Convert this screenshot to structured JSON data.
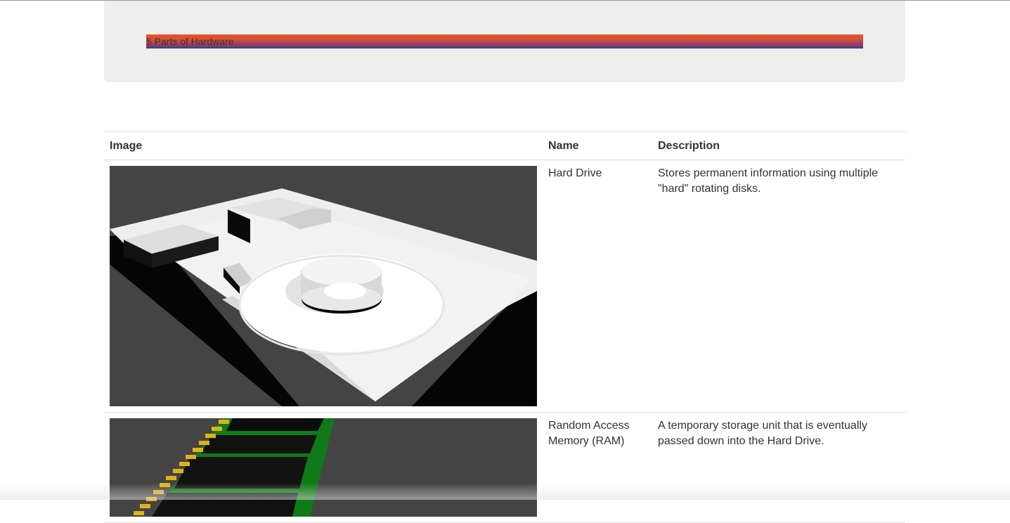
{
  "header": {
    "title": "5 Parts of Hardware"
  },
  "table": {
    "columns": [
      "Image",
      "Name",
      "Description"
    ],
    "rows": [
      {
        "name": "Hard Drive",
        "description": "Stores permanent information using multiple \"hard\" rotating disks.",
        "image_icon": "hard-drive-3d-render"
      },
      {
        "name": "Random Access Memory (RAM)",
        "description": "A temporary storage unit that is eventually passed down into the Hard Drive.",
        "image_icon": "ram-stick-3d-render"
      }
    ]
  },
  "colors": {
    "title_gradient_top": "#e1572b",
    "title_gradient_bottom": "#3b3f8a",
    "jumbotron_bg": "#eeeeee",
    "render_bg": "#444444",
    "ram_pcb": "#0f7a17",
    "ram_pins": "#e0b21a"
  }
}
